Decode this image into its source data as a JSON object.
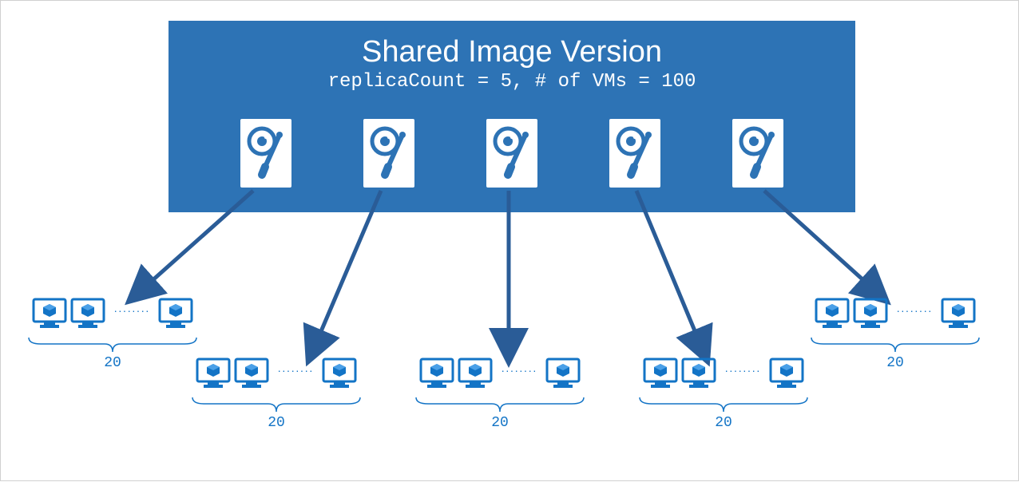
{
  "header": {
    "title": "Shared Image Version",
    "subtitle": "replicaCount = 5, # of VMs = 100"
  },
  "replicas": {
    "count": 5,
    "icon": "disk-icon"
  },
  "clusters": [
    {
      "vms_per_replica": "20"
    },
    {
      "vms_per_replica": "20"
    },
    {
      "vms_per_replica": "20"
    },
    {
      "vms_per_replica": "20"
    },
    {
      "vms_per_replica": "20"
    }
  ],
  "colors": {
    "header_bg": "#2d73b5",
    "accent": "#1374c6",
    "arrow": "#2a5c97"
  },
  "ellipsis": "········"
}
